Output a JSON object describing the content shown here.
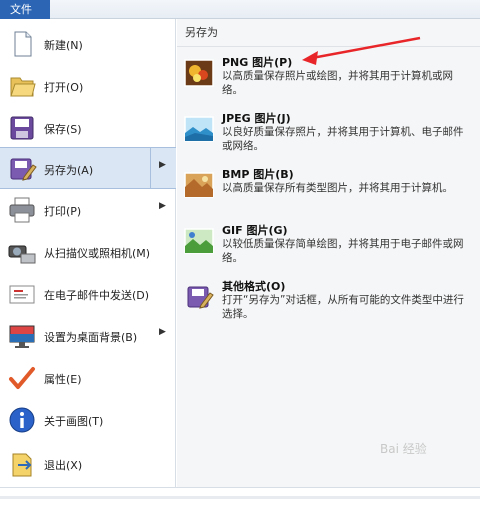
{
  "file_tab": "文件",
  "left_menu": [
    {
      "label": "新建(N)",
      "icon": "new-document-icon"
    },
    {
      "label": "打开(O)",
      "icon": "open-folder-icon"
    },
    {
      "label": "保存(S)",
      "icon": "save-disk-icon"
    },
    {
      "label": "另存为(A)",
      "icon": "save-as-icon",
      "has_submenu": true,
      "selected": true
    },
    {
      "label": "打印(P)",
      "icon": "printer-icon",
      "has_submenu": true
    },
    {
      "label": "从扫描仪或照相机(M)",
      "icon": "scanner-camera-icon"
    },
    {
      "label": "在电子邮件中发送(D)",
      "icon": "email-icon"
    },
    {
      "label": "设置为桌面背景(B)",
      "icon": "desktop-background-icon",
      "has_submenu": true
    },
    {
      "label": "属性(E)",
      "icon": "checkmark-icon"
    },
    {
      "label": "关于画图(T)",
      "icon": "info-icon"
    },
    {
      "label": "退出(X)",
      "icon": "exit-icon"
    }
  ],
  "submenu": {
    "header": "另存为",
    "options": [
      {
        "title": "PNG 图片(P)",
        "desc": "以高质量保存照片或绘图，并将其用于计算机或网络。",
        "icon": "png-image-icon"
      },
      {
        "title": "JPEG 图片(J)",
        "desc": "以良好质量保存照片，并将其用于计算机、电子邮件或网络。",
        "icon": "jpeg-image-icon"
      },
      {
        "title": "BMP 图片(B)",
        "desc": "以高质量保存所有类型图片，并将其用于计算机。",
        "icon": "bmp-image-icon"
      },
      {
        "title": "GIF 图片(G)",
        "desc": "以较低质量保存简单绘图，并将其用于电子邮件或网络。",
        "icon": "gif-image-icon"
      },
      {
        "title": "其他格式(O)",
        "desc": "打开“另存为”对话框，从所有可能的文件类型中进行选择。",
        "icon": "other-formats-icon"
      }
    ]
  },
  "watermark": "Bai 经验",
  "colors": {
    "file_tab": "#2b65b4",
    "selected_bg": "#dbe6f4",
    "annotation_arrow": "#e8262a"
  }
}
